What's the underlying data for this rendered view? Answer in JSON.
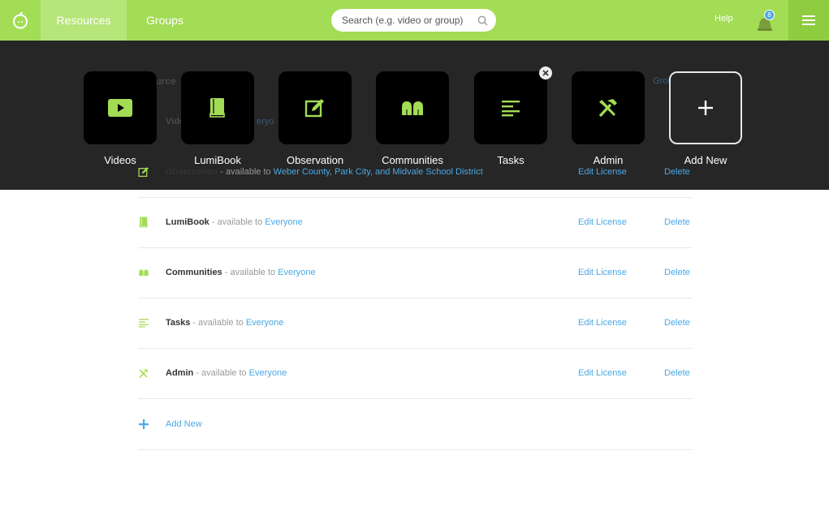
{
  "nav": {
    "tabs": [
      {
        "label": "Resources",
        "active": true
      },
      {
        "label": "Groups",
        "active": false
      }
    ],
    "search_placeholder": "Search (e.g. video or group)",
    "help_label": "Help",
    "notification_count": "8"
  },
  "overlay": {
    "tiles": [
      {
        "label": "Videos",
        "icon": "video-icon"
      },
      {
        "label": "LumiBook",
        "icon": "book-icon"
      },
      {
        "label": "Observation",
        "icon": "edit-icon"
      },
      {
        "label": "Communities",
        "icon": "people-icon"
      },
      {
        "label": "Tasks",
        "icon": "list-icon"
      },
      {
        "label": "Admin",
        "icon": "tools-icon"
      },
      {
        "label": "Add New",
        "icon": "plus-icon"
      }
    ],
    "ghost": {
      "title_fragment": "ource",
      "row_fragment_name": "Vide",
      "row_fragment_link": "eryo",
      "header_right": "Grou",
      "delete_fragment": "elete"
    }
  },
  "resources": {
    "separator": " - available to ",
    "edit_label": "Edit License",
    "delete_label": "Delete",
    "rows": [
      {
        "name": "Observation",
        "availability": "Weber County, Park City, and Midvale School District",
        "icon": "edit-icon"
      },
      {
        "name": "LumiBook",
        "availability": "Everyone",
        "icon": "book-icon"
      },
      {
        "name": "Communities",
        "availability": "Everyone",
        "icon": "people-icon"
      },
      {
        "name": "Tasks",
        "availability": "Everyone",
        "icon": "list-icon"
      },
      {
        "name": "Admin",
        "availability": "Everyone",
        "icon": "tools-icon"
      }
    ],
    "add_new_label": "Add New"
  },
  "colors": {
    "brand_green": "#a3dc55",
    "active_tab": "#b6e57a",
    "link_blue": "#4aa8e6",
    "overlay": "#262626"
  }
}
